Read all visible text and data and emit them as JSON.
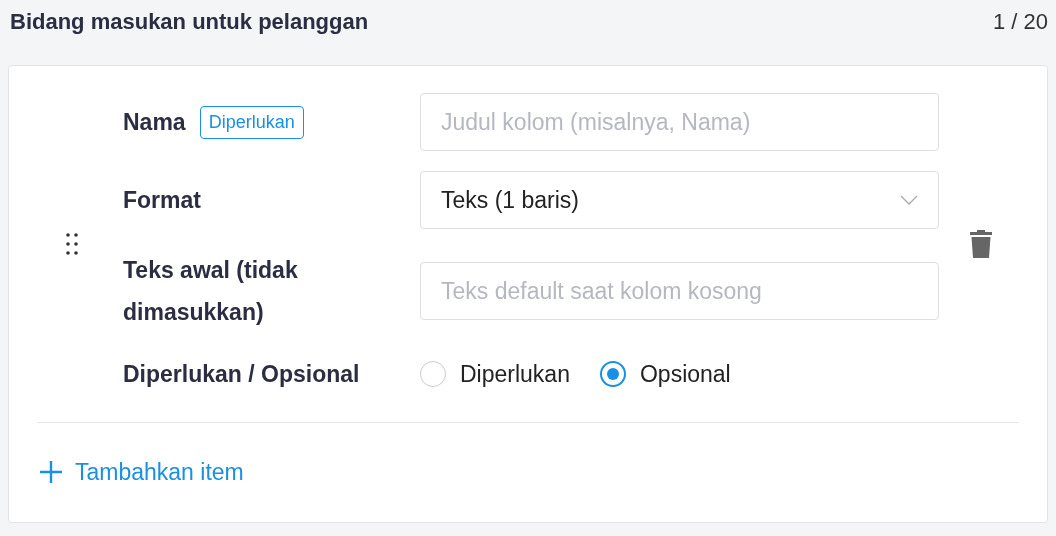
{
  "header": {
    "title": "Bidang masukan untuk pelanggan",
    "counter": "1 / 20"
  },
  "fields": [
    {
      "kind": "text",
      "label": "Nama",
      "badge": "Diperlukan",
      "placeholder": "Judul kolom (misalnya, Nama)"
    },
    {
      "kind": "select",
      "label": "Format",
      "value": "Teks (1 baris)"
    },
    {
      "kind": "text",
      "label": "Teks awal (tidak dimasukkan)",
      "placeholder": "Teks default saat kolom kosong"
    },
    {
      "kind": "radio",
      "label": "Diperlukan / Opsional",
      "options": [
        {
          "label": "Diperlukan",
          "selected": false
        },
        {
          "label": "Opsional",
          "selected": true
        }
      ]
    }
  ],
  "add_button": {
    "label": "Tambahkan item"
  }
}
